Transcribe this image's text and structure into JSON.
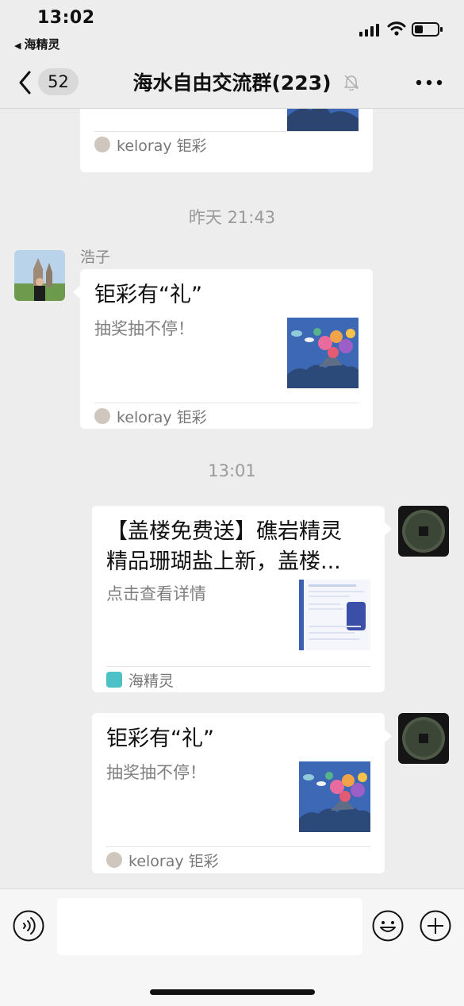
{
  "status_bar": {
    "time": "13:02",
    "back_app_label": "海精灵"
  },
  "nav": {
    "unread_count": "52",
    "title": "海水自由交流群",
    "member_count": "(223)"
  },
  "messages": {
    "card0": {
      "source": "keloray 钜彩"
    },
    "timestamp1": "昨天 21:43",
    "card1": {
      "sender": "浩子",
      "title": "钜彩有“礼”",
      "desc": "抽奖抽不停！",
      "source": "keloray 钜彩"
    },
    "timestamp2": "13:01",
    "card2": {
      "title_line1": "【盖楼免费送】礁岩精灵",
      "title_line2": "精品珊瑚盐上新，盖楼...",
      "desc": "点击查看详情",
      "source": "海精灵"
    },
    "card3": {
      "title": "钜彩有“礼”",
      "desc": "抽奖抽不停！",
      "source": "keloray 钜彩"
    }
  },
  "input": {
    "placeholder": ""
  },
  "colors": {
    "background": "#ededed",
    "card": "#ffffff",
    "thumb_blue": "#3d68b5"
  }
}
